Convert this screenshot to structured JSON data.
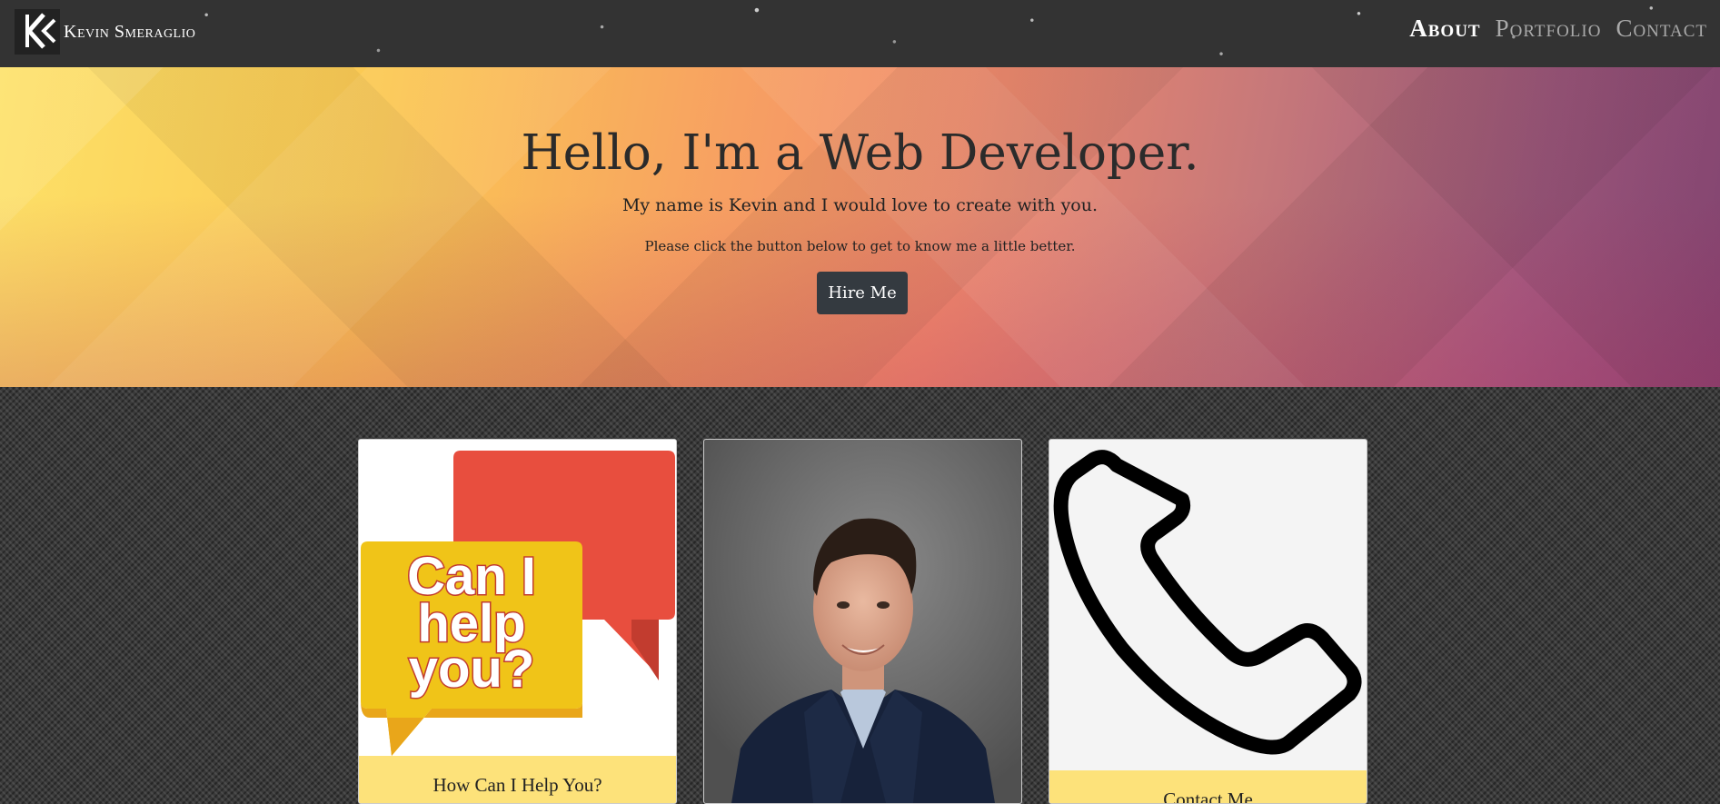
{
  "navbar": {
    "brand": "Kevin Smeraglio",
    "links": [
      "About",
      "Portfolio",
      "Contact"
    ],
    "active": "About"
  },
  "hero": {
    "title": "Hello, I'm a Web Developer.",
    "subtitle": "My name is Kevin and I would love to create with you.",
    "prompt": "Please click the button below to get to know me a little better.",
    "button_label": "Hire Me"
  },
  "cards": [
    {
      "image": "speech-bubbles-can-i-help-you",
      "image_text": [
        "Can I",
        "help",
        "you?"
      ],
      "caption": "How Can I Help You?"
    },
    {
      "image": "portrait-photo",
      "caption": ""
    },
    {
      "image": "phone-icon",
      "caption": "Contact Me"
    }
  ],
  "colors": {
    "navbar": "#333333",
    "button": "#343a40",
    "caption_bg": "#fde27a",
    "bubble_red": "#e84e3e",
    "bubble_yellow": "#f0c418"
  }
}
